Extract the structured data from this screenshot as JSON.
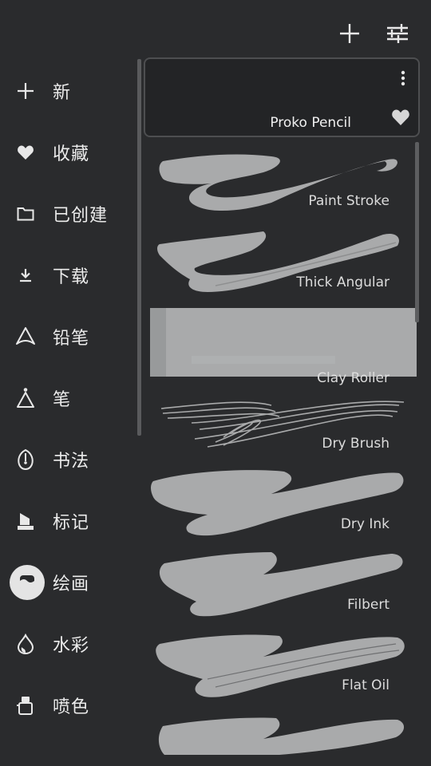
{
  "toolbar": {
    "add_icon": "plus-icon",
    "filter_icon": "sliders-icon"
  },
  "sidebar": {
    "items": [
      {
        "label": "新",
        "icon": "plus-icon"
      },
      {
        "label": "收藏",
        "icon": "heart-icon"
      },
      {
        "label": "已创建",
        "icon": "folder-icon"
      },
      {
        "label": "下载",
        "icon": "download-icon"
      },
      {
        "label": "铅笔",
        "icon": "pencil-tip-icon"
      },
      {
        "label": "笔",
        "icon": "pen-nib-icon"
      },
      {
        "label": "书法",
        "icon": "calligraphy-nib-icon"
      },
      {
        "label": "标记",
        "icon": "marker-icon"
      },
      {
        "label": "绘画",
        "icon": "paint-pot-icon",
        "active": true
      },
      {
        "label": "水彩",
        "icon": "water-drop-icon"
      },
      {
        "label": "喷色",
        "icon": "spray-can-icon"
      }
    ]
  },
  "brushes": [
    {
      "name": "Proko Pencil",
      "selected": true,
      "favorite": true
    },
    {
      "name": "Paint Stroke"
    },
    {
      "name": "Thick Angular"
    },
    {
      "name": "Clay Roller"
    },
    {
      "name": "Dry Brush"
    },
    {
      "name": "Dry Ink"
    },
    {
      "name": "Filbert"
    },
    {
      "name": "Flat Oil"
    },
    {
      "name": ""
    }
  ],
  "colors": {
    "background": "#2a2b2d",
    "stroke": "#a9aaab",
    "active_bg": "#e4e4e4"
  }
}
